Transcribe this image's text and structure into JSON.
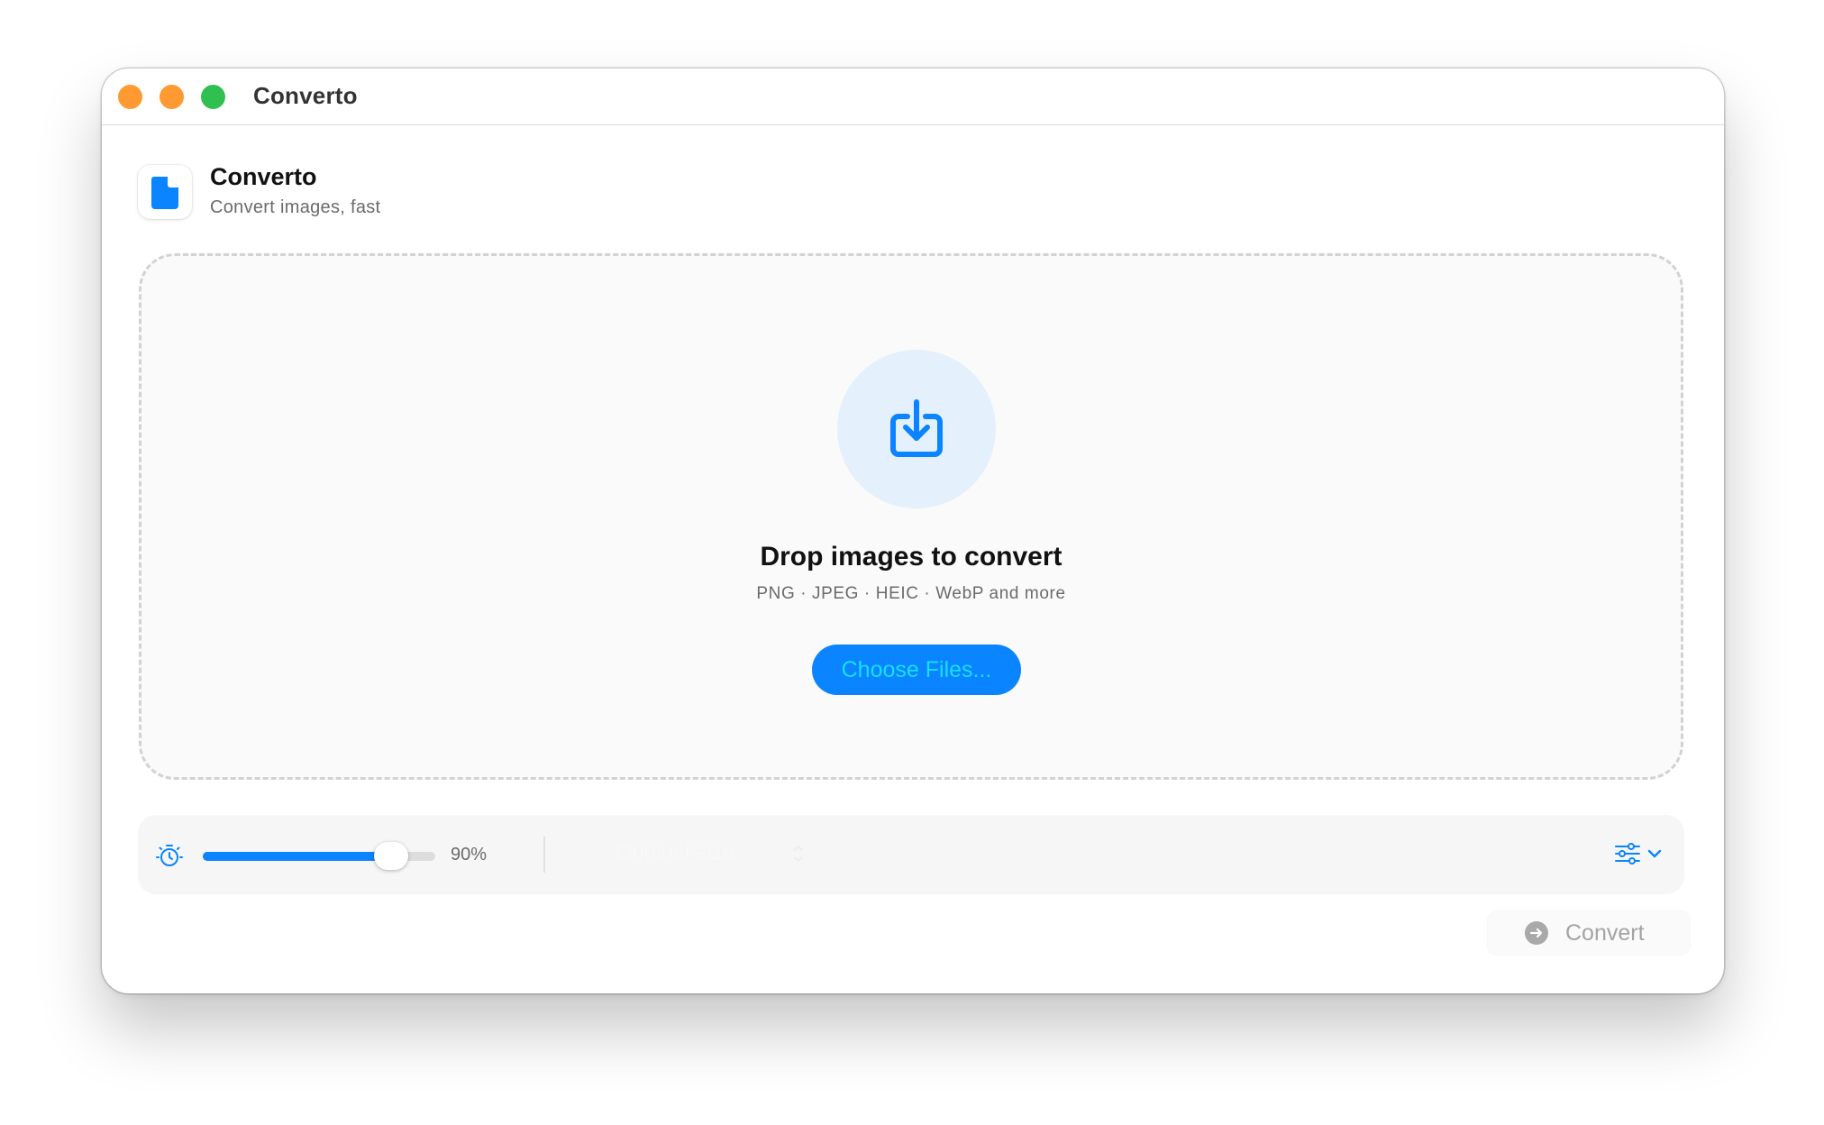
{
  "window": {
    "title": "Converto",
    "traffic_lights": [
      "#ff9a33",
      "#ff9a33",
      "#30c04f"
    ]
  },
  "header": {
    "app_name": "Converto",
    "subtitle": "Convert images, fast",
    "icon": "document-icon"
  },
  "dropzone": {
    "icon": "import-tray-icon",
    "title": "Drop images to convert",
    "formats": "PNG · JPEG · HEIC · WebP and more",
    "choose_label": "Choose Files..."
  },
  "toolbar": {
    "quality_icon": "timer-icon",
    "quality_value": 0.9,
    "quality_label": "90%",
    "size_select_value": "Original size",
    "size_icon": "up-down-chevron-icon",
    "settings_icon": "sliders-icon"
  },
  "footer": {
    "convert_label": "Convert",
    "convert_icon": "arrow-circle-icon"
  },
  "colors": {
    "accent": "#0a84ff",
    "choose_text": "#16e0ff",
    "drop_circle": "#e4f0fb"
  }
}
